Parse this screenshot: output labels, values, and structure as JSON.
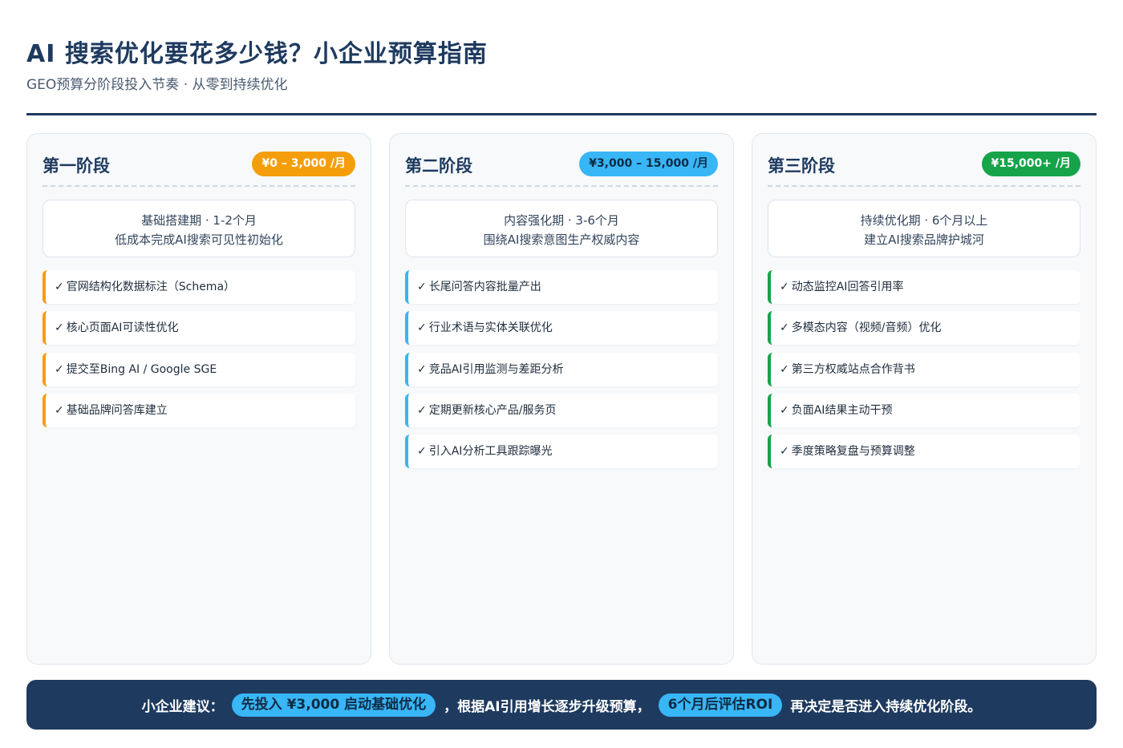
{
  "header": {
    "title": "AI 搜索优化要花多少钱？小企业预算指南",
    "subtitle": "GEO预算分阶段投入节奏 · 从零到持续优化"
  },
  "stages": [
    {
      "name": "第一阶段",
      "price": "¥0 – 3,000 /月",
      "accent": "#f59e0b",
      "desc_line1": "基础搭建期 · 1-2个月",
      "desc_line2": "低成本完成AI搜索可见性初始化",
      "items": [
        "官网结构化数据标注（Schema）",
        "核心页面AI可读性优化",
        "提交至Bing AI / Google SGE",
        "基础品牌问答库建立"
      ]
    },
    {
      "name": "第二阶段",
      "price": "¥3,000 – 15,000 /月",
      "accent": "#38b6f5",
      "desc_line1": "内容强化期 · 3-6个月",
      "desc_line2": "围绕AI搜索意图生产权威内容",
      "items": [
        "长尾问答内容批量产出",
        "行业术语与实体关联优化",
        "竞品AI引用监测与差距分析",
        "定期更新核心产品/服务页",
        "引入AI分析工具跟踪曝光"
      ]
    },
    {
      "name": "第三阶段",
      "price": "¥15,000+ /月",
      "accent": "#16a34a",
      "desc_line1": "持续优化期 · 6个月以上",
      "desc_line2": "建立AI搜索品牌护城河",
      "items": [
        "动态监控AI回答引用率",
        "多模态内容（视频/音频）优化",
        "第三方权威站点合作背书",
        "负面AI结果主动干预",
        "季度策略复盘与预算调整"
      ]
    }
  ],
  "check_mark": "✓",
  "banner": {
    "lead": "小企业建议：",
    "pill1": "先投入 ¥3,000 启动基础优化",
    "middle": "，根据AI引用增长逐步升级预算，",
    "pill2": "6个月后评估ROI",
    "tail": "再决定是否进入持续优化阶段。"
  }
}
